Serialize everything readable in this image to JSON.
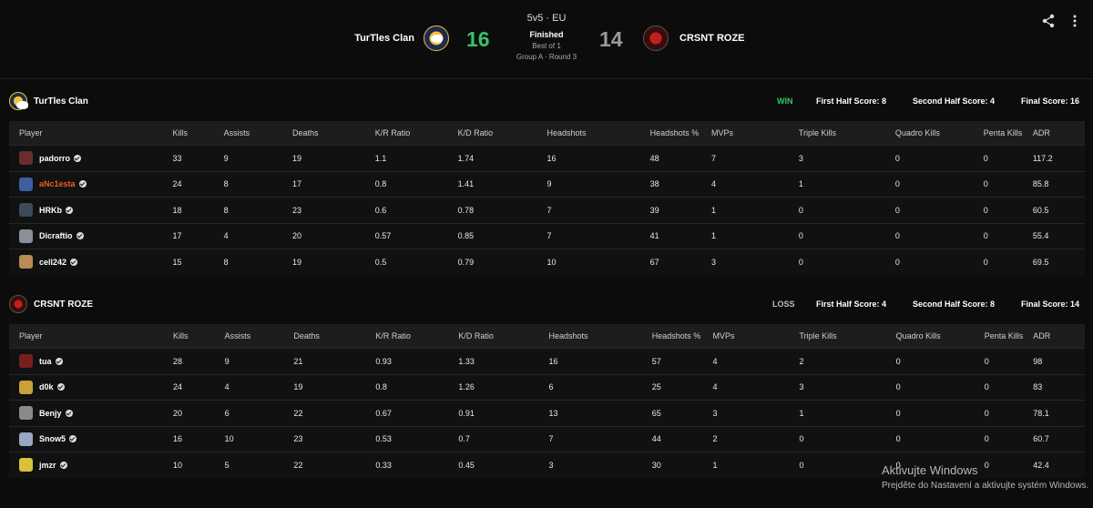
{
  "match": {
    "mode": "5v5 · EU",
    "status": "Finished",
    "best_of": "Best of 1",
    "round": "Group A · Round 3",
    "team1": {
      "name": "TurTles Clan",
      "score": "16"
    },
    "team2": {
      "name": "CRSNT ROZE",
      "score": "14"
    }
  },
  "icons": {
    "share": "share-icon",
    "more": "more-vertical-icon",
    "verified": "verified-check-icon"
  },
  "colors": {
    "win": "#37c36a",
    "loss_score": "#9a9a9a",
    "highlight_player": "#f15a24"
  },
  "columns": [
    "Player",
    "Kills",
    "Assists",
    "Deaths",
    "K/R Ratio",
    "K/D Ratio",
    "Headshots",
    "Headshots %",
    "MVPs",
    "Triple Kills",
    "Quadro Kills",
    "Penta Kills",
    "ADR"
  ],
  "teams": [
    {
      "name": "TurTles Clan",
      "result": "WIN",
      "first_half": "First Half Score: 8",
      "second_half": "Second Half Score: 4",
      "final": "Final Score: 16",
      "players": [
        [
          "padorro",
          "33",
          "9",
          "19",
          "1.1",
          "1.74",
          "16",
          "48",
          "7",
          "3",
          "0",
          "0",
          "117.2"
        ],
        [
          "aNc1esta",
          "24",
          "8",
          "17",
          "0.8",
          "1.41",
          "9",
          "38",
          "4",
          "1",
          "0",
          "0",
          "85.8"
        ],
        [
          "HRKb",
          "18",
          "8",
          "23",
          "0.6",
          "0.78",
          "7",
          "39",
          "1",
          "0",
          "0",
          "0",
          "60.5"
        ],
        [
          "Dicraftio",
          "17",
          "4",
          "20",
          "0.57",
          "0.85",
          "7",
          "41",
          "1",
          "0",
          "0",
          "0",
          "55.4"
        ],
        [
          "cell242",
          "15",
          "8",
          "19",
          "0.5",
          "0.79",
          "10",
          "67",
          "3",
          "0",
          "0",
          "0",
          "69.5"
        ]
      ]
    },
    {
      "name": "CRSNT ROZE",
      "result": "LOSS",
      "first_half": "First Half Score: 4",
      "second_half": "Second Half Score: 8",
      "final": "Final Score: 14",
      "players": [
        [
          "tua",
          "28",
          "9",
          "21",
          "0.93",
          "1.33",
          "16",
          "57",
          "4",
          "2",
          "0",
          "0",
          "98"
        ],
        [
          "d0k",
          "24",
          "4",
          "19",
          "0.8",
          "1.26",
          "6",
          "25",
          "4",
          "3",
          "0",
          "0",
          "83"
        ],
        [
          "Benjy",
          "20",
          "6",
          "22",
          "0.67",
          "0.91",
          "13",
          "65",
          "3",
          "1",
          "0",
          "0",
          "78.1"
        ],
        [
          "Snow5",
          "16",
          "10",
          "23",
          "0.53",
          "0.7",
          "7",
          "44",
          "2",
          "0",
          "0",
          "0",
          "60.7"
        ],
        [
          "jmzr",
          "10",
          "5",
          "22",
          "0.33",
          "0.45",
          "3",
          "30",
          "1",
          "0",
          "0",
          "0",
          "42.4"
        ]
      ]
    }
  ],
  "watermark": {
    "line1": "Aktivujte Windows",
    "line2": "Prejděte do Nastavení a aktivujte systém Windows."
  }
}
